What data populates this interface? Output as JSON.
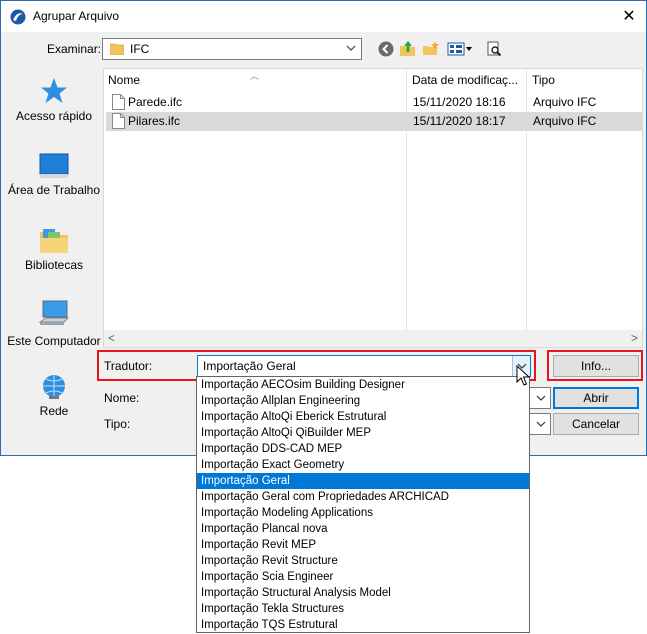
{
  "window": {
    "title": "Agrupar Arquivo",
    "close_glyph": "✕"
  },
  "lookin": {
    "label": "Examinar:",
    "value": "IFC"
  },
  "toolbar": {
    "icons": [
      "back-icon",
      "up-folder-icon",
      "new-folder-icon",
      "view-menu-icon",
      "preview-icon"
    ]
  },
  "places": [
    {
      "label": "Acesso rápido",
      "icon": "star-icon"
    },
    {
      "label": "Área de Trabalho",
      "icon": "desktop-icon"
    },
    {
      "label": "Bibliotecas",
      "icon": "libraries-icon"
    },
    {
      "label": "Este Computador",
      "icon": "computer-icon"
    },
    {
      "label": "Rede",
      "icon": "network-icon"
    }
  ],
  "filelist": {
    "columns": [
      "Nome",
      "Data de modificaç...",
      "Tipo"
    ],
    "rows": [
      {
        "name": "Parede.ifc",
        "date": "15/11/2020 18:16",
        "type": "Arquivo IFC",
        "selected": false
      },
      {
        "name": "Pilares.ifc",
        "date": "15/11/2020 18:17",
        "type": "Arquivo IFC",
        "selected": true
      }
    ]
  },
  "translator": {
    "label": "Tradutor:",
    "value": "Importação Geral",
    "info_label": "Info..."
  },
  "filename": {
    "label": "Nome:",
    "open_label": "Abrir"
  },
  "filetype": {
    "label": "Tipo:",
    "cancel_label": "Cancelar"
  },
  "dropdown": {
    "options": [
      "Importação AECOsim Building Designer",
      "Importação Allplan Engineering",
      "Importação AltoQi Eberick Estrutural",
      "Importação AltoQi QiBuilder MEP",
      "Importação DDS-CAD MEP",
      "Importação Exact Geometry",
      "Importação Geral",
      "Importação Geral com Propriedades ARCHICAD",
      "Importação Modeling Applications",
      "Importação Plancal nova",
      "Importação Revit MEP",
      "Importação Revit Structure",
      "Importação Scia Engineer",
      "Importação Structural Analysis Model",
      "Importação Tekla Structures",
      "Importação TQS Estrutural"
    ],
    "selected": "Importação Geral"
  },
  "colors": {
    "accent": "#0078d7",
    "highlight_box": "#e8141b",
    "selected_row": "#d9d9d9"
  }
}
